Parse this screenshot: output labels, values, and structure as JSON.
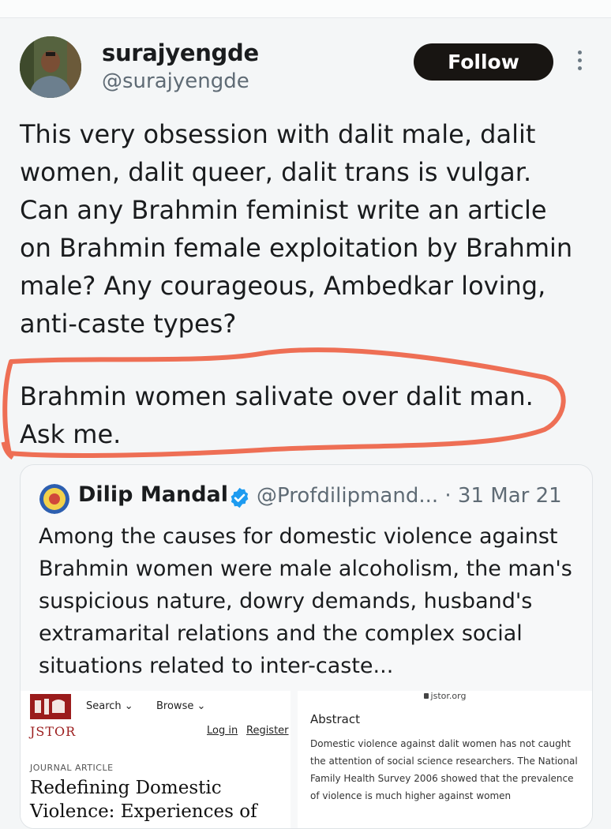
{
  "tweet": {
    "display_name": "surajyengde",
    "handle": "@surajyengde",
    "follow_label": "Follow",
    "text_part1": "This very obsession with dalit male, dalit\nwomen, dalit queer, dalit trans is vulgar.\nCan any Brahmin feminist write an article\non Brahmin female exploitation by Brahmin\nmale? Any courageous, Ambedkar loving,\nanti-caste types?",
    "text_part2": "Brahmin women salivate over dalit man.\nAsk me."
  },
  "quoted_tweet": {
    "display_name": "Dilip Mandal",
    "handle_and_date": "@Profdilipmand... · 31 Mar 21",
    "text": "Among the causes for domestic violence against Brahmin women were male alcoholism, the man's suspicious nature, dowry demands, husband's extramarital relations and the complex social situations related to inter-caste..."
  },
  "attached_image": {
    "left": {
      "logo_text": "JSTOR",
      "nav_search": "Search ⌄",
      "nav_browse": "Browse ⌄",
      "login": "Log in",
      "register": "Register",
      "article_type": "JOURNAL ARTICLE",
      "article_title": "Redefining Domestic\nViolence: Experiences of"
    },
    "right": {
      "url": "jstor.org",
      "abstract_heading": "Abstract",
      "abstract_text": "Domestic violence against dalit women has not caught the attention of social science researchers. The National Family Health Survey 2006 showed that the prevalence of violence is much higher against women"
    }
  },
  "colors": {
    "follow_bg": "#181512",
    "highlight_circle": "#ee6f55",
    "verified_badge": "#1d9bf0",
    "jstor_red": "#9b1c1c"
  },
  "icons": [
    "more-options-icon",
    "verified-badge-icon",
    "jstor-logo-icon",
    "lock-icon"
  ]
}
